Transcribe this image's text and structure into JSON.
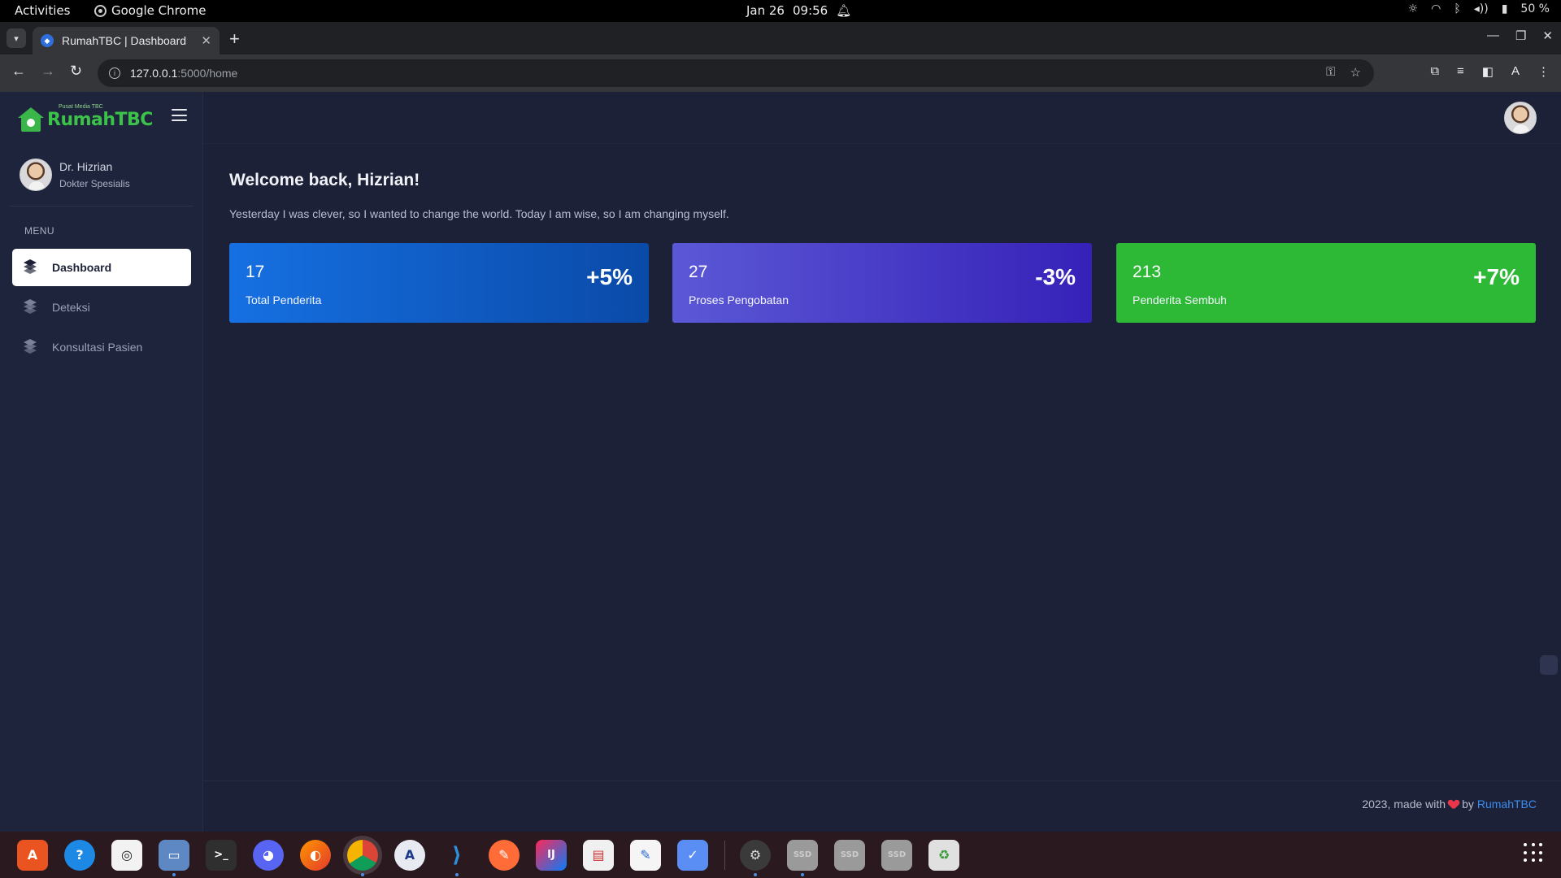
{
  "system": {
    "activities": "Activities",
    "app_name": "Google Chrome",
    "date": "Jan 26",
    "time": "09:56",
    "battery": "50 %"
  },
  "browser": {
    "tab_title": "RumahTBC | Dashboard",
    "url_host": "127.0.0.1",
    "url_path": ":5000/home",
    "profile_initial": "A"
  },
  "sidebar": {
    "brand_tagline": "Pusat Media TBC",
    "brand_name": "RumahTBC",
    "user_name": "Dr. Hizrian",
    "user_role": "Dokter Spesialis",
    "menu_label": "MENU",
    "items": [
      {
        "label": "Dashboard",
        "icon": "layers-icon",
        "active": true
      },
      {
        "label": "Deteksi",
        "icon": "layers-icon",
        "active": false
      },
      {
        "label": "Konsultasi Pasien",
        "icon": "layers-icon",
        "active": false
      }
    ]
  },
  "main": {
    "welcome": "Welcome back, Hizrian!",
    "quote": "Yesterday I was clever, so I wanted to change the world. Today I am wise, so I am changing myself.",
    "cards": [
      {
        "count": "17",
        "label": "Total Penderita",
        "change": "+5%",
        "color": "#1670e2"
      },
      {
        "count": "27",
        "label": "Proses Pengobatan",
        "change": "-3%",
        "color": "#5b58d6"
      },
      {
        "count": "213",
        "label": "Penderita Sembuh",
        "change": "+7%",
        "color": "#2db836"
      }
    ]
  },
  "footer": {
    "prefix": "2023, made with",
    "middle": "by",
    "link": "RumahTBC"
  },
  "dock": {
    "apps": [
      "software-center",
      "help",
      "rhythmbox",
      "files",
      "terminal",
      "discord",
      "firefox",
      "chrome",
      "app-store",
      "vscode",
      "postman",
      "intellij",
      "document-viewer",
      "text-editor",
      "tasks",
      "settings",
      "disk-1",
      "disk-2",
      "disk-3",
      "trash"
    ]
  }
}
